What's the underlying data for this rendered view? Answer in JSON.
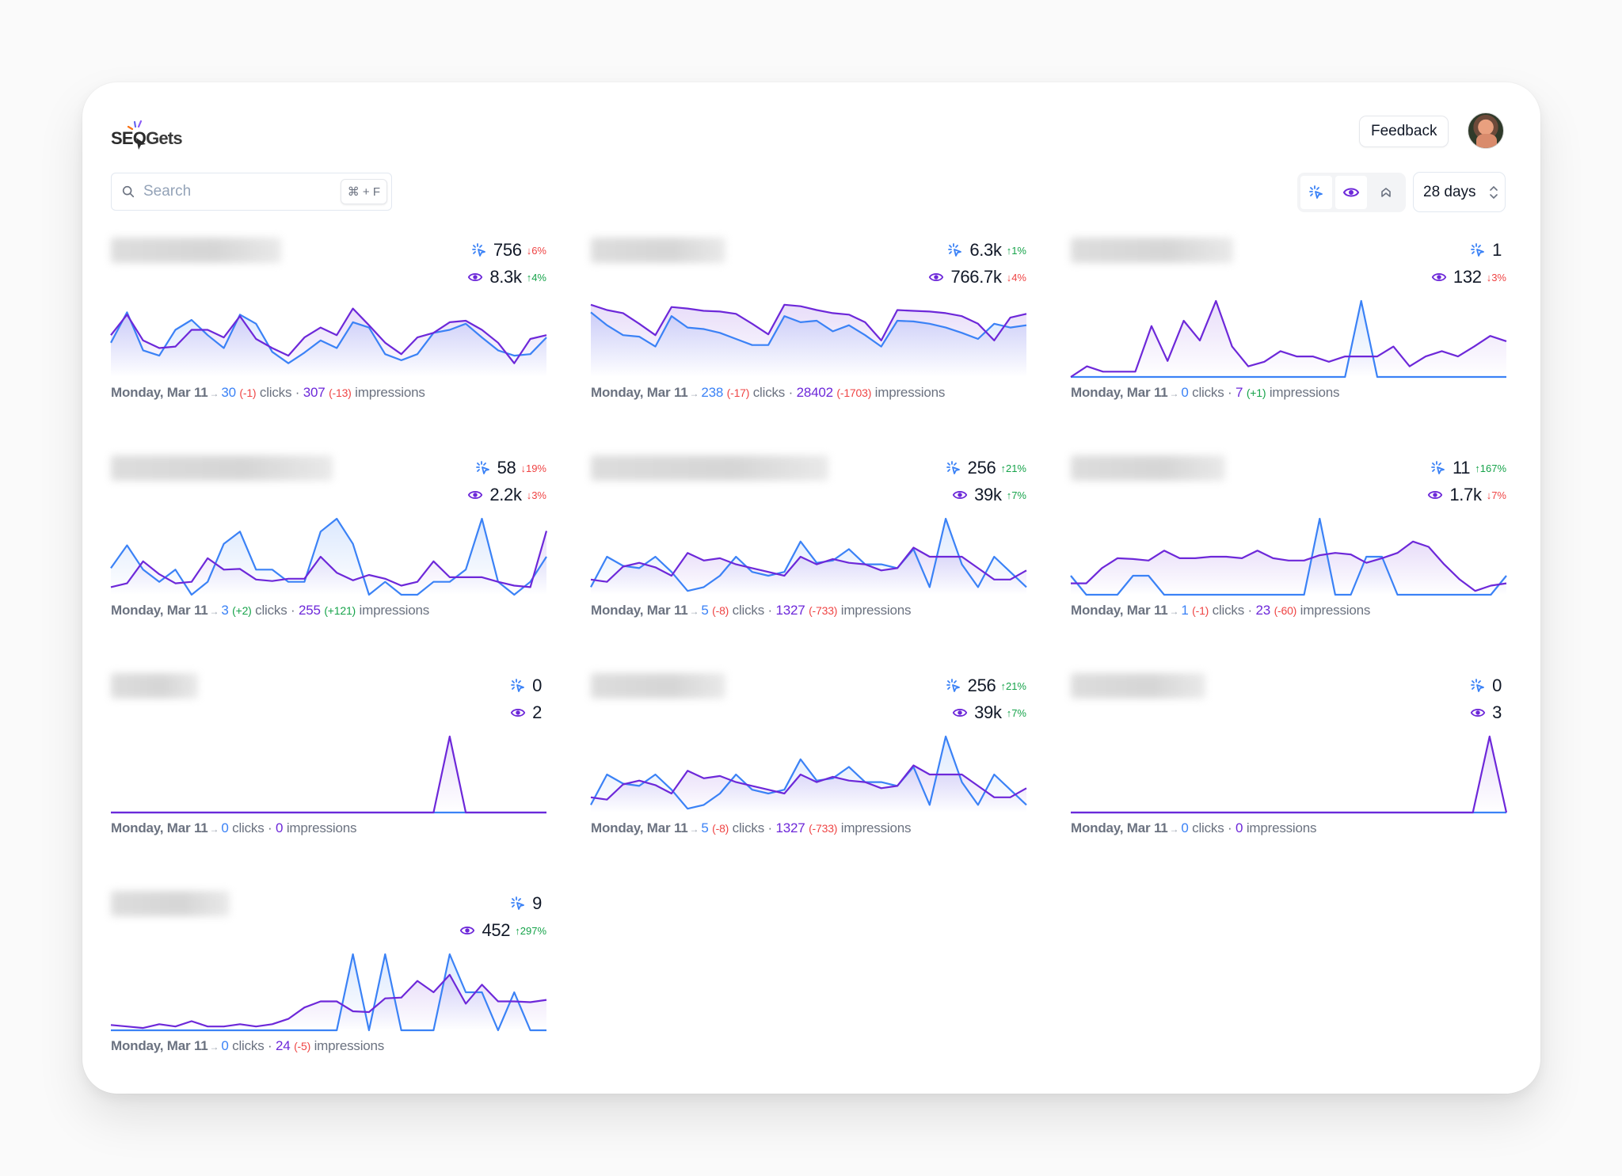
{
  "app": {
    "name_part1": "SEO",
    "name_part2": "Gets"
  },
  "header": {
    "feedback_label": "Feedback",
    "avatar_alt": "User avatar"
  },
  "search": {
    "placeholder": "Search",
    "value": "",
    "shortcut": "⌘ + F"
  },
  "toolbar": {
    "toggles": [
      {
        "name": "clicks",
        "icon": "click-icon",
        "active": true
      },
      {
        "name": "impressions",
        "icon": "eye-icon",
        "active": true
      },
      {
        "name": "position",
        "icon": "position-chevron-icon",
        "active": false
      }
    ],
    "date_range": {
      "selected": "28 days"
    }
  },
  "colors": {
    "clicks": "#3b82f6",
    "impressions": "#6d28d9",
    "down": "#ef4444",
    "up": "#16a34a"
  },
  "sites": [
    {
      "name_blurred": true,
      "clicks": "756",
      "clicks_delta": "↓6%",
      "clicks_dir": "down",
      "impressions": "8.3k",
      "impressions_delta": "↑4%",
      "impressions_dir": "up",
      "footer": {
        "date": "Monday, Mar 11",
        "clicks": "30",
        "clicks_change": "(-1)",
        "clicks_change_dir": "down",
        "impressions": "307",
        "impressions_change": "(-13)",
        "impressions_change_dir": "down"
      }
    },
    {
      "name_blurred": true,
      "clicks": "6.3k",
      "clicks_delta": "↑1%",
      "clicks_dir": "up",
      "impressions": "766.7k",
      "impressions_delta": "↓4%",
      "impressions_dir": "down",
      "footer": {
        "date": "Monday, Mar 11",
        "clicks": "238",
        "clicks_change": "(-17)",
        "clicks_change_dir": "down",
        "impressions": "28402",
        "impressions_change": "(-1703)",
        "impressions_change_dir": "down"
      }
    },
    {
      "name_blurred": true,
      "clicks": "1",
      "clicks_delta": "",
      "clicks_dir": "",
      "impressions": "132",
      "impressions_delta": "↓3%",
      "impressions_dir": "down",
      "footer": {
        "date": "Monday, Mar 11",
        "clicks": "0",
        "clicks_change": "",
        "clicks_change_dir": "",
        "impressions": "7",
        "impressions_change": "(+1)",
        "impressions_change_dir": "up"
      }
    },
    {
      "name_blurred": true,
      "clicks": "58",
      "clicks_delta": "↓19%",
      "clicks_dir": "down",
      "impressions": "2.2k",
      "impressions_delta": "↓3%",
      "impressions_dir": "down",
      "footer": {
        "date": "Monday, Mar 11",
        "clicks": "3",
        "clicks_change": "(+2)",
        "clicks_change_dir": "up",
        "impressions": "255",
        "impressions_change": "(+121)",
        "impressions_change_dir": "up"
      }
    },
    {
      "name_blurred": true,
      "clicks": "256",
      "clicks_delta": "↑21%",
      "clicks_dir": "up",
      "impressions": "39k",
      "impressions_delta": "↑7%",
      "impressions_dir": "up",
      "footer": {
        "date": "Monday, Mar 11",
        "clicks": "5",
        "clicks_change": "(-8)",
        "clicks_change_dir": "down",
        "impressions": "1327",
        "impressions_change": "(-733)",
        "impressions_change_dir": "down"
      }
    },
    {
      "name_blurred": true,
      "clicks": "11",
      "clicks_delta": "↑167%",
      "clicks_dir": "up",
      "impressions": "1.7k",
      "impressions_delta": "↓7%",
      "impressions_dir": "down",
      "footer": {
        "date": "Monday, Mar 11",
        "clicks": "1",
        "clicks_change": "(-1)",
        "clicks_change_dir": "down",
        "impressions": "23",
        "impressions_change": "(-60)",
        "impressions_change_dir": "down"
      }
    },
    {
      "name_blurred": true,
      "clicks": "0",
      "clicks_delta": "",
      "clicks_dir": "",
      "impressions": "2",
      "impressions_delta": "",
      "impressions_dir": "",
      "footer": {
        "date": "Monday, Mar 11",
        "clicks": "0",
        "clicks_change": "",
        "clicks_change_dir": "",
        "impressions": "0",
        "impressions_change": "",
        "impressions_change_dir": ""
      }
    },
    {
      "name_blurred": true,
      "clicks": "256",
      "clicks_delta": "↑21%",
      "clicks_dir": "up",
      "impressions": "39k",
      "impressions_delta": "↑7%",
      "impressions_dir": "up",
      "footer": {
        "date": "Monday, Mar 11",
        "clicks": "5",
        "clicks_change": "(-8)",
        "clicks_change_dir": "down",
        "impressions": "1327",
        "impressions_change": "(-733)",
        "impressions_change_dir": "down"
      }
    },
    {
      "name_blurred": true,
      "clicks": "0",
      "clicks_delta": "",
      "clicks_dir": "",
      "impressions": "3",
      "impressions_delta": "",
      "impressions_dir": "",
      "footer": {
        "date": "Monday, Mar 11",
        "clicks": "0",
        "clicks_change": "",
        "clicks_change_dir": "",
        "impressions": "0",
        "impressions_change": "",
        "impressions_change_dir": ""
      }
    },
    {
      "name_blurred": true,
      "clicks": "9",
      "clicks_delta": "",
      "clicks_dir": "",
      "impressions": "452",
      "impressions_delta": "↑297%",
      "impressions_dir": "up",
      "footer": {
        "date": "Monday, Mar 11",
        "clicks": "0",
        "clicks_change": "",
        "clicks_change_dir": "",
        "impressions": "24",
        "impressions_change": "(-5)",
        "impressions_change_dir": "down"
      }
    }
  ],
  "chart_data": [
    {
      "type": "line",
      "title": "site-1",
      "series": [
        {
          "name": "clicks",
          "values": [
            0.45,
            0.85,
            0.35,
            0.28,
            0.62,
            0.75,
            0.55,
            0.38,
            0.82,
            0.7,
            0.33,
            0.18,
            0.32,
            0.48,
            0.38,
            0.72,
            0.65,
            0.3,
            0.22,
            0.3,
            0.58,
            0.62,
            0.7,
            0.52,
            0.35,
            0.28,
            0.3,
            0.52
          ]
        },
        {
          "name": "impressions",
          "values": [
            0.55,
            0.82,
            0.48,
            0.38,
            0.4,
            0.62,
            0.62,
            0.52,
            0.8,
            0.5,
            0.38,
            0.28,
            0.52,
            0.65,
            0.55,
            0.9,
            0.68,
            0.45,
            0.3,
            0.52,
            0.58,
            0.72,
            0.74,
            0.62,
            0.45,
            0.18,
            0.5,
            0.55
          ]
        }
      ]
    },
    {
      "type": "line",
      "title": "site-2",
      "series": [
        {
          "name": "clicks",
          "values": [
            0.85,
            0.68,
            0.55,
            0.53,
            0.4,
            0.8,
            0.65,
            0.63,
            0.58,
            0.5,
            0.42,
            0.42,
            0.8,
            0.72,
            0.74,
            0.6,
            0.68,
            0.55,
            0.4,
            0.74,
            0.73,
            0.7,
            0.65,
            0.58,
            0.5,
            0.7,
            0.65,
            0.68
          ]
        },
        {
          "name": "impressions",
          "values": [
            0.95,
            0.88,
            0.84,
            0.7,
            0.55,
            0.92,
            0.9,
            0.87,
            0.86,
            0.83,
            0.7,
            0.56,
            0.95,
            0.93,
            0.88,
            0.84,
            0.82,
            0.72,
            0.48,
            0.88,
            0.87,
            0.86,
            0.84,
            0.8,
            0.7,
            0.48,
            0.78,
            0.83
          ]
        }
      ]
    },
    {
      "type": "line",
      "title": "site-3",
      "series": [
        {
          "name": "clicks",
          "values": [
            0,
            0,
            0,
            0,
            0,
            0,
            0,
            0,
            0,
            0,
            0,
            0,
            0,
            0,
            0,
            0,
            0,
            0,
            1,
            0,
            0,
            0,
            0,
            0,
            0,
            0,
            0,
            0
          ]
        },
        {
          "name": "impressions",
          "values": [
            0,
            0.14,
            0.07,
            0.07,
            0.07,
            0.67,
            0.21,
            0.74,
            0.48,
            1.0,
            0.4,
            0.14,
            0.2,
            0.34,
            0.27,
            0.27,
            0.2,
            0.27,
            0.27,
            0.27,
            0.4,
            0.14,
            0.27,
            0.34,
            0.27,
            0.4,
            0.54,
            0.47
          ]
        }
      ]
    },
    {
      "type": "line",
      "title": "site-4",
      "series": [
        {
          "name": "clicks",
          "values": [
            0.35,
            0.65,
            0.33,
            0.17,
            0.33,
            0,
            0.17,
            0.67,
            0.83,
            0.33,
            0.33,
            0.17,
            0.17,
            0.83,
            1.0,
            0.67,
            0,
            0.17,
            0,
            0,
            0.17,
            0.17,
            0.33,
            1.0,
            0.17,
            0,
            0.17,
            0.5
          ]
        },
        {
          "name": "impressions",
          "values": [
            0.1,
            0.15,
            0.44,
            0.27,
            0.15,
            0.17,
            0.48,
            0.33,
            0.34,
            0.2,
            0.18,
            0.21,
            0.21,
            0.5,
            0.29,
            0.19,
            0.26,
            0.21,
            0.12,
            0.17,
            0.44,
            0.23,
            0.23,
            0.23,
            0.17,
            0.12,
            0.1,
            0.84
          ]
        }
      ]
    },
    {
      "type": "line",
      "title": "site-5",
      "series": [
        {
          "name": "clicks",
          "values": [
            0.1,
            0.5,
            0.38,
            0.35,
            0.5,
            0.3,
            0.05,
            0.1,
            0.25,
            0.5,
            0.3,
            0.25,
            0.3,
            0.7,
            0.42,
            0.45,
            0.6,
            0.4,
            0.4,
            0.35,
            0.6,
            0.1,
            1.0,
            0.4,
            0.1,
            0.5,
            0.3,
            0.1
          ]
        },
        {
          "name": "impressions",
          "values": [
            0.2,
            0.17,
            0.37,
            0.42,
            0.36,
            0.25,
            0.55,
            0.45,
            0.48,
            0.4,
            0.35,
            0.3,
            0.25,
            0.5,
            0.4,
            0.47,
            0.42,
            0.4,
            0.32,
            0.35,
            0.62,
            0.5,
            0.5,
            0.5,
            0.35,
            0.2,
            0.2,
            0.32
          ]
        }
      ]
    },
    {
      "type": "line",
      "title": "site-6",
      "series": [
        {
          "name": "clicks",
          "values": [
            0.25,
            0,
            0,
            0,
            0.25,
            0.25,
            0,
            0,
            0,
            0,
            0,
            0,
            0,
            0,
            0,
            0,
            1.0,
            0,
            0,
            0.5,
            0.5,
            0,
            0,
            0,
            0,
            0,
            0,
            0,
            0.25
          ]
        },
        {
          "name": "impressions",
          "values": [
            0.15,
            0.15,
            0.35,
            0.48,
            0.47,
            0.45,
            0.58,
            0.48,
            0.48,
            0.5,
            0.5,
            0.48,
            0.58,
            0.48,
            0.45,
            0.45,
            0.52,
            0.55,
            0.53,
            0.42,
            0.48,
            0.55,
            0.7,
            0.63,
            0.4,
            0.2,
            0.05,
            0.12,
            0.15
          ]
        }
      ]
    },
    {
      "type": "line",
      "title": "site-7",
      "series": [
        {
          "name": "clicks",
          "values": [
            0,
            0,
            0,
            0,
            0,
            0,
            0,
            0,
            0,
            0,
            0,
            0,
            0,
            0,
            0,
            0,
            0,
            0,
            0,
            0,
            0,
            0,
            0,
            0,
            0,
            0,
            0,
            0
          ]
        },
        {
          "name": "impressions",
          "values": [
            0,
            0,
            0,
            0,
            0,
            0,
            0,
            0,
            0,
            0,
            0,
            0,
            0,
            0,
            0,
            0,
            0,
            0,
            0,
            0,
            0,
            1,
            0,
            0,
            0,
            0,
            0,
            0
          ]
        }
      ]
    },
    {
      "type": "line",
      "title": "site-8",
      "series": [
        {
          "name": "clicks",
          "values": [
            0.1,
            0.5,
            0.38,
            0.35,
            0.5,
            0.3,
            0.05,
            0.1,
            0.25,
            0.5,
            0.3,
            0.25,
            0.3,
            0.7,
            0.42,
            0.45,
            0.6,
            0.4,
            0.4,
            0.35,
            0.6,
            0.1,
            1.0,
            0.4,
            0.1,
            0.5,
            0.3,
            0.1
          ]
        },
        {
          "name": "impressions",
          "values": [
            0.2,
            0.17,
            0.37,
            0.42,
            0.36,
            0.25,
            0.55,
            0.45,
            0.48,
            0.4,
            0.35,
            0.3,
            0.25,
            0.5,
            0.4,
            0.47,
            0.42,
            0.4,
            0.32,
            0.35,
            0.62,
            0.5,
            0.5,
            0.5,
            0.35,
            0.2,
            0.2,
            0.32
          ]
        }
      ]
    },
    {
      "type": "line",
      "title": "site-9",
      "series": [
        {
          "name": "clicks",
          "values": [
            0,
            0,
            0,
            0,
            0,
            0,
            0,
            0,
            0,
            0,
            0,
            0,
            0,
            0,
            0,
            0,
            0,
            0,
            0,
            0,
            0,
            0,
            0,
            0,
            0,
            0,
            0,
            0
          ]
        },
        {
          "name": "impressions",
          "values": [
            0,
            0,
            0,
            0,
            0,
            0,
            0,
            0,
            0,
            0,
            0,
            0,
            0,
            0,
            0,
            0,
            0,
            0,
            0,
            0,
            0,
            0,
            0,
            0,
            0,
            1,
            0
          ]
        }
      ]
    },
    {
      "type": "line",
      "title": "site-10",
      "series": [
        {
          "name": "clicks",
          "values": [
            0,
            0,
            0,
            0,
            0,
            0,
            0,
            0,
            0,
            0,
            0,
            0,
            0,
            0,
            0,
            1,
            0,
            1,
            0,
            0,
            0,
            1,
            0.5,
            0.5,
            0,
            0.5,
            0,
            0
          ]
        },
        {
          "name": "impressions",
          "values": [
            0.07,
            0.05,
            0.03,
            0.08,
            0.05,
            0.12,
            0.05,
            0.05,
            0.08,
            0.05,
            0.08,
            0.15,
            0.3,
            0.38,
            0.38,
            0.25,
            0.24,
            0.42,
            0.43,
            0.65,
            0.5,
            0.73,
            0.35,
            0.6,
            0.38,
            0.38,
            0.37,
            0.4
          ]
        }
      ]
    }
  ]
}
